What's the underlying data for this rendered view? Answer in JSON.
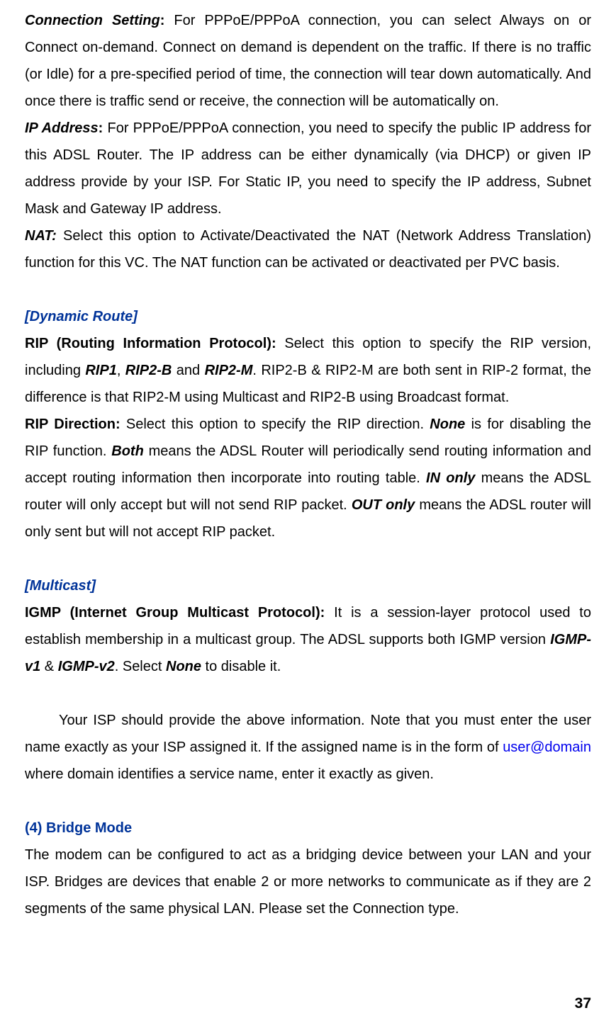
{
  "para1": {
    "label": "Connection Setting",
    "colon": ":",
    "text": " For PPPoE/PPPoA connection, you can select Always on or Connect on-demand. Connect on demand is dependent on the traffic. If there is no traffic (or Idle) for a pre-specified period of time, the connection will tear down automatically. And once there is traffic send or receive, the connection will be automatically on."
  },
  "para2": {
    "label": "IP Address",
    "colon": ":",
    "text": " For PPPoE/PPPoA connection, you need to specify the public IP address for this ADSL Router. The IP address can be either dynamically (via DHCP) or given IP address provide by your ISP. For Static IP, you need to specify the IP address, Subnet Mask and Gateway IP address."
  },
  "para3": {
    "label": "NAT:",
    "text": " Select this option to Activate/Deactivated the NAT (Network Address Translation) function for this VC. The NAT function can be activated or deactivated per PVC basis."
  },
  "dynamicRoute": "[Dynamic Route]",
  "rip": {
    "label": "RIP (Routing Information Protocol):",
    "t1": " Select this option to specify the RIP version, including ",
    "rip1": "RIP1",
    "comma": ", ",
    "rip2b": "RIP2-B",
    "and": " and ",
    "rip2m": "RIP2-M",
    "t2": ". RIP2-B & RIP2-M are both sent in RIP-2 format, the difference is that RIP2-M using Multicast and RIP2-B using Broadcast format."
  },
  "ripDir": {
    "label": "RIP Direction:",
    "t1": " Select this option to specify the RIP direction. ",
    "none": "None",
    "t2": " is for disabling the RIP function. ",
    "both": "Both",
    "t3": " means the ADSL Router will periodically send routing information and accept routing information then incorporate into routing table. ",
    "inonly": "IN only",
    "t4": " means the ADSL router will only accept but will not send RIP packet. ",
    "outonly": "OUT only",
    "t5": " means the ADSL router will only sent but will not accept RIP packet."
  },
  "multicast": "[Multicast]",
  "igmp": {
    "label": "IGMP (Internet Group Multicast Protocol):",
    "t1": " It is a session-layer protocol used to establish membership in a multicast group. The ADSL supports both IGMP version ",
    "v1": "IGMP-v1",
    "amp": " & ",
    "v2": "IGMP-v2",
    "t2": ". Select ",
    "none": "None",
    "t3": " to disable it."
  },
  "isp": {
    "t1": "Your ISP should provide the above information. Note that you must enter the user name exactly as your ISP assigned it. If the assigned name is in the form of ",
    "link": "user@domain",
    "t2": " where domain identifies a service name, enter it exactly as given."
  },
  "bridge": {
    "heading": "(4) Bridge Mode",
    "text": "The modem can be configured to act as a bridging device between your LAN and your ISP. Bridges are devices that enable 2 or more networks to communicate as if they are 2 segments of the same physical LAN. Please set the Connection type."
  },
  "pageNumber": "37"
}
